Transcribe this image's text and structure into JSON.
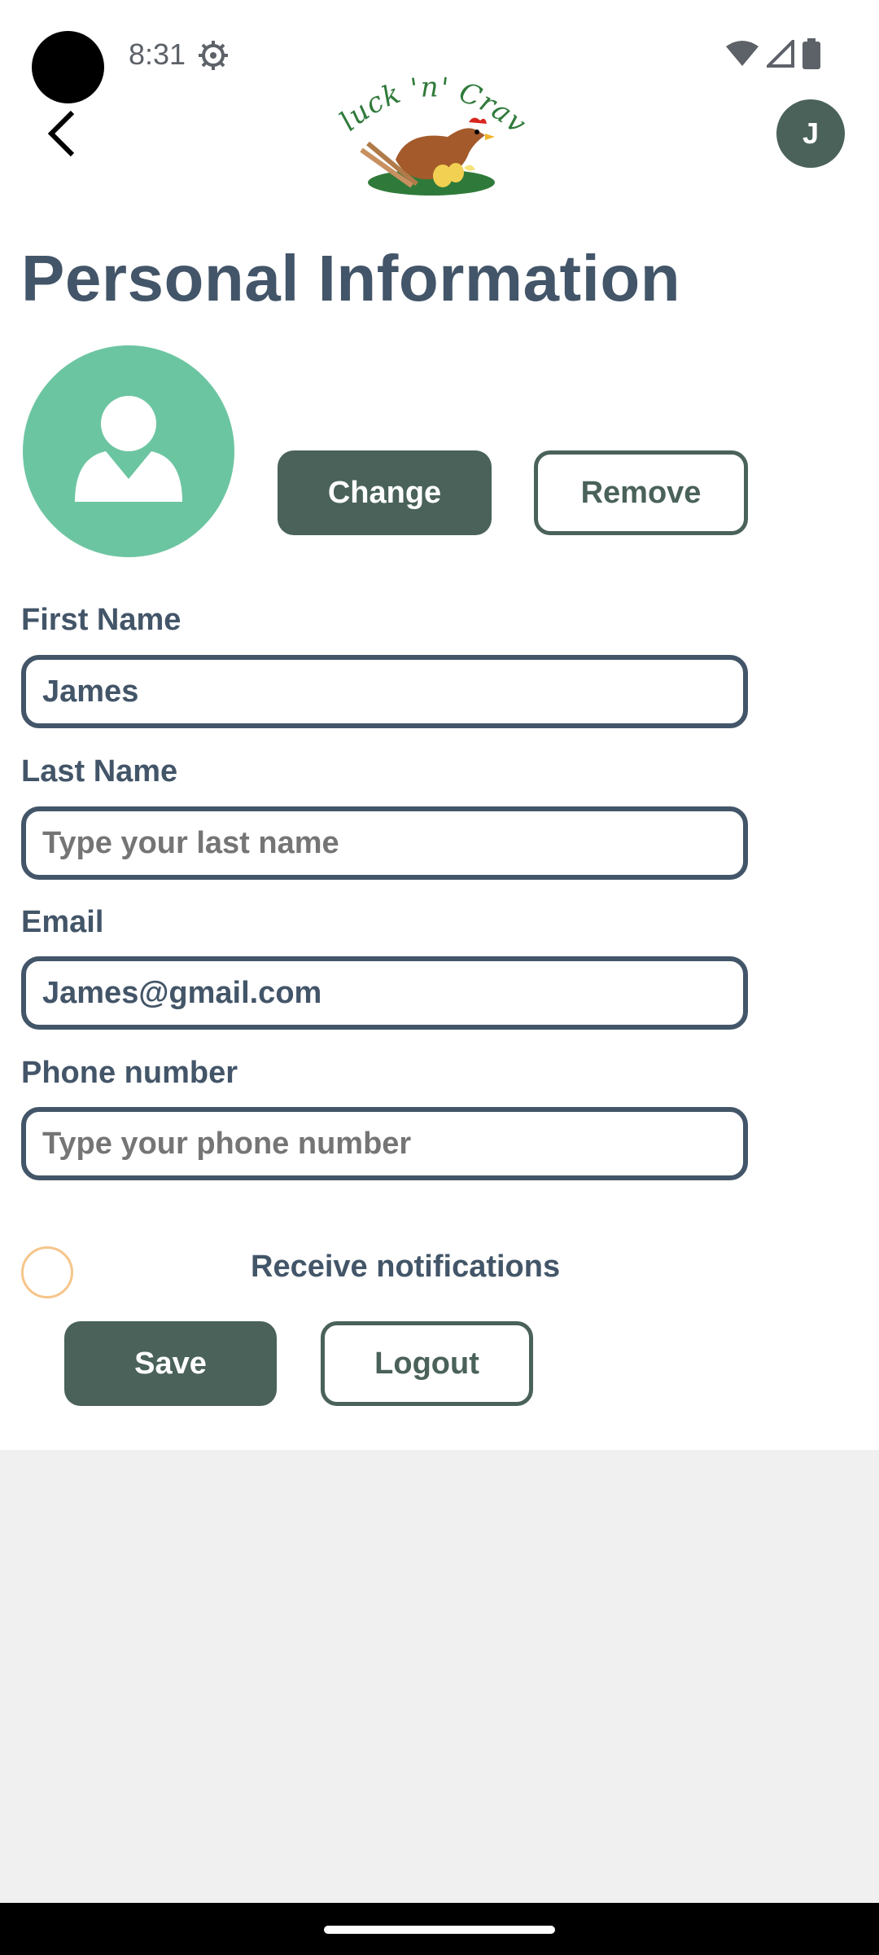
{
  "status_bar": {
    "time": "8:31",
    "icons": [
      "settings-gear-icon",
      "wifi-icon",
      "cellular-signal-icon",
      "battery-icon"
    ]
  },
  "header": {
    "back_icon": "chevron-left-icon",
    "logo_text": "Cluck 'n' Crave",
    "avatar_initial": "J",
    "brand_color": "#4a6259"
  },
  "page": {
    "title": "Personal Information"
  },
  "profile": {
    "picture_icon": "user-avatar-icon",
    "picture_color": "#6cc5a1",
    "change_label": "Change",
    "remove_label": "Remove"
  },
  "form": {
    "first_name": {
      "label": "First Name",
      "value": "James",
      "placeholder": ""
    },
    "last_name": {
      "label": "Last Name",
      "value": "",
      "placeholder": "Type your last name"
    },
    "email": {
      "label": "Email",
      "value": "James@gmail.com",
      "placeholder": ""
    },
    "phone": {
      "label": "Phone number",
      "value": "",
      "placeholder": "Type your phone number"
    }
  },
  "notifications": {
    "label": "Receive notifications",
    "checked": false
  },
  "actions": {
    "save_label": "Save",
    "logout_label": "Logout"
  }
}
